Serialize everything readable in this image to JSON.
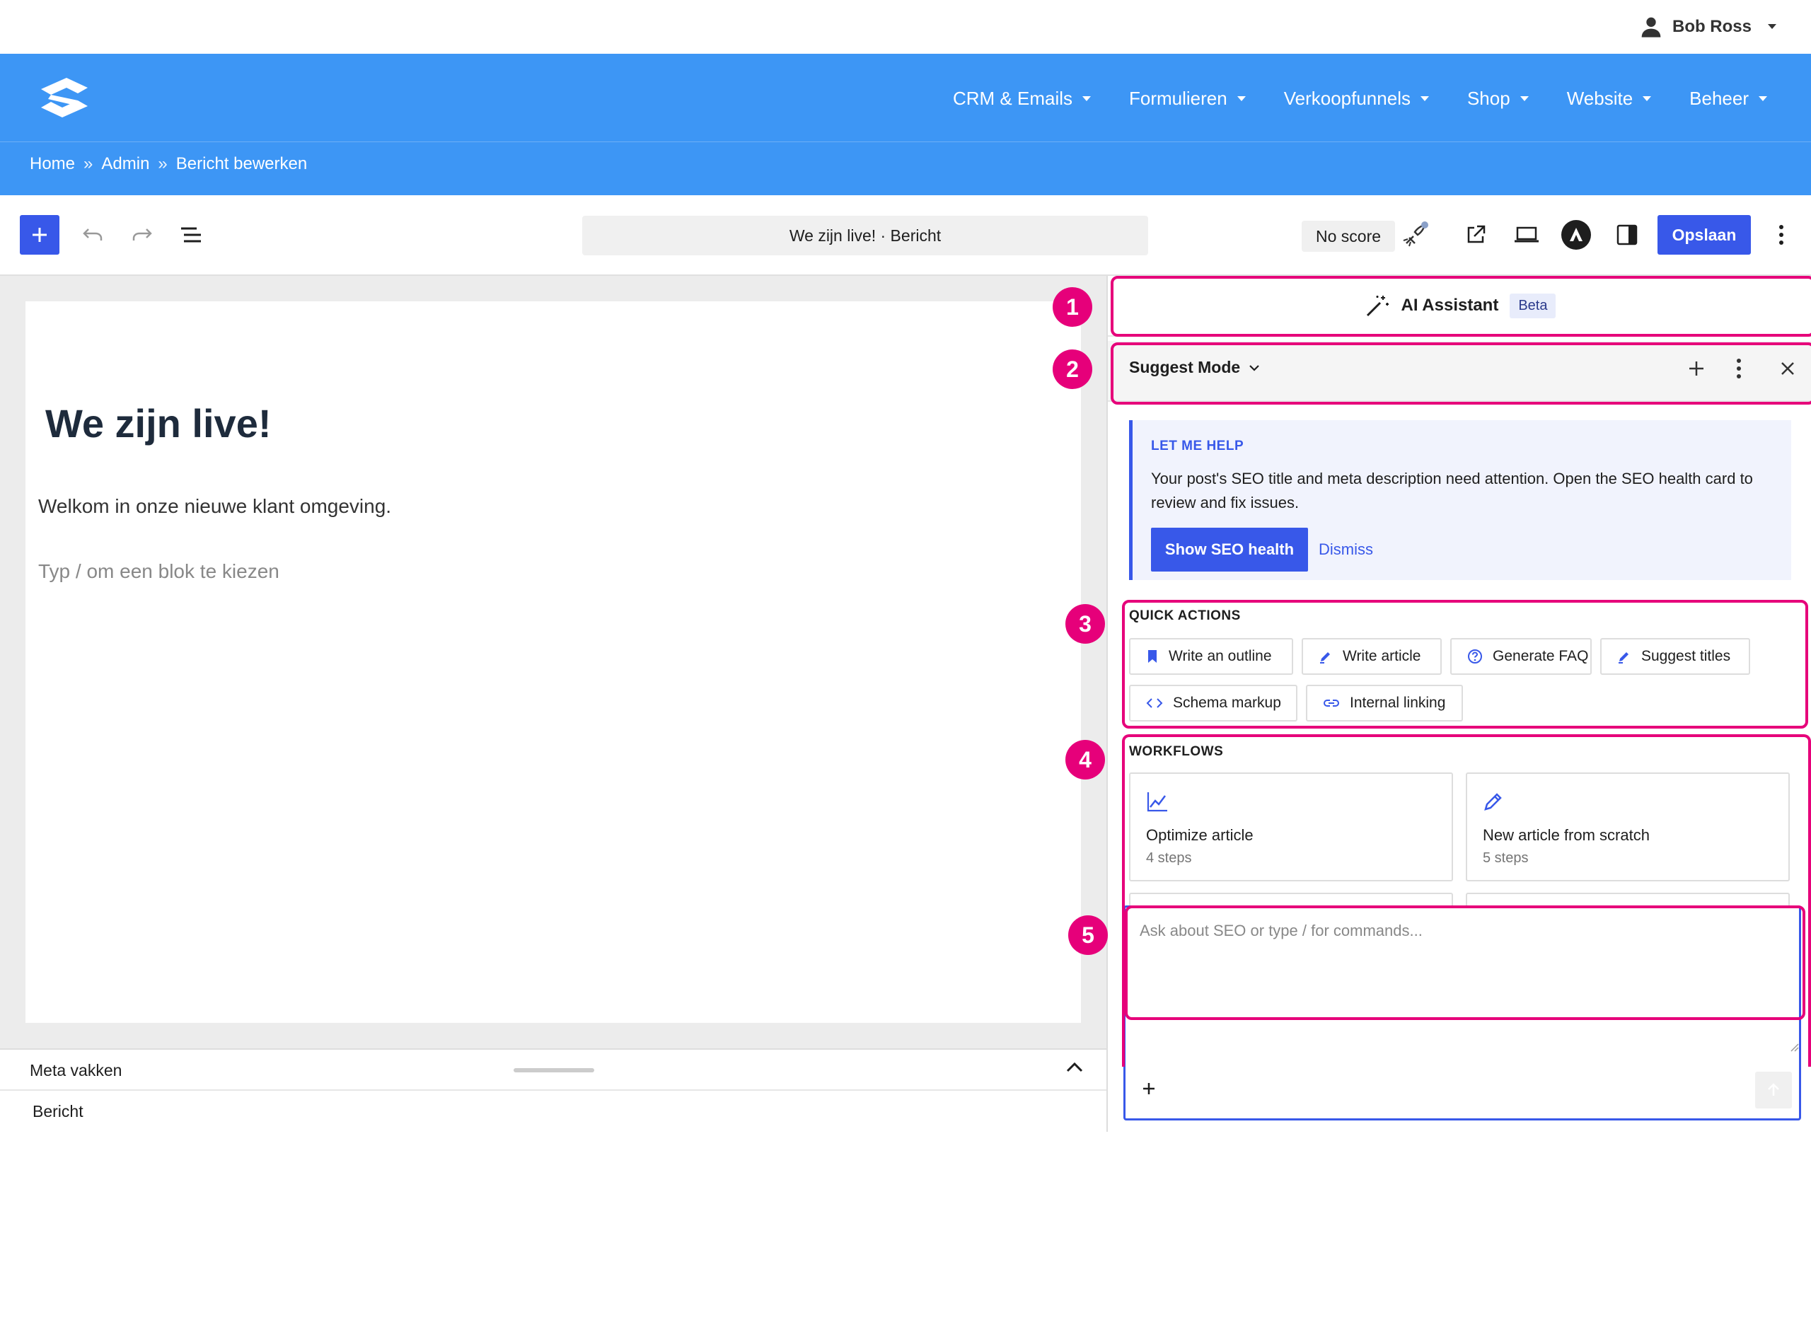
{
  "user": {
    "name": "Bob Ross"
  },
  "nav": {
    "items": [
      {
        "label": "CRM & Emails"
      },
      {
        "label": "Formulieren"
      },
      {
        "label": "Verkoopfunnels"
      },
      {
        "label": "Shop"
      },
      {
        "label": "Website"
      },
      {
        "label": "Beheer"
      }
    ]
  },
  "breadcrumb": {
    "home": "Home",
    "admin": "Admin",
    "current": "Bericht bewerken",
    "separator": "»"
  },
  "toolbar": {
    "document_title": "We zijn live! · Bericht",
    "score": "No score",
    "save_label": "Opslaan"
  },
  "post": {
    "title": "We zijn live!",
    "paragraph": "Welkom in onze nieuwe klant omgeving.",
    "placeholder": "Typ / om een blok te kiezen"
  },
  "meta": {
    "title": "Meta vakken",
    "sub": "Bericht"
  },
  "assistant": {
    "title": "AI Assistant",
    "badge": "Beta",
    "mode": "Suggest Mode",
    "help": {
      "label": "LET ME HELP",
      "text": "Your post's SEO title and meta description need attention. Open the SEO health card to review and fix issues.",
      "primary": "Show SEO health",
      "secondary": "Dismiss"
    },
    "quick_actions": {
      "label": "QUICK ACTIONS",
      "items": [
        {
          "label": "Write an outline",
          "icon": "bookmark-icon"
        },
        {
          "label": "Write article",
          "icon": "pencil-icon"
        },
        {
          "label": "Generate FAQ",
          "icon": "question-circle-icon"
        },
        {
          "label": "Suggest titles",
          "icon": "pencil-icon"
        },
        {
          "label": "Schema markup",
          "icon": "code-icon"
        },
        {
          "label": "Internal linking",
          "icon": "link-icon"
        }
      ]
    },
    "workflows": {
      "label": "WORKFLOWS",
      "items": [
        {
          "title": "Optimize article",
          "steps": "4 steps",
          "icon": "chart-line-icon"
        },
        {
          "title": "New article from scratch",
          "steps": "5 steps",
          "icon": "pencil-icon"
        }
      ]
    },
    "chat": {
      "placeholder": "Ask about SEO or type / for commands..."
    }
  },
  "annotations": {
    "markers": [
      "1",
      "2",
      "3",
      "4",
      "5"
    ]
  },
  "colors": {
    "nav_blue": "#3d96f5",
    "accent": "#3858e9",
    "highlight": "#e6007a"
  }
}
